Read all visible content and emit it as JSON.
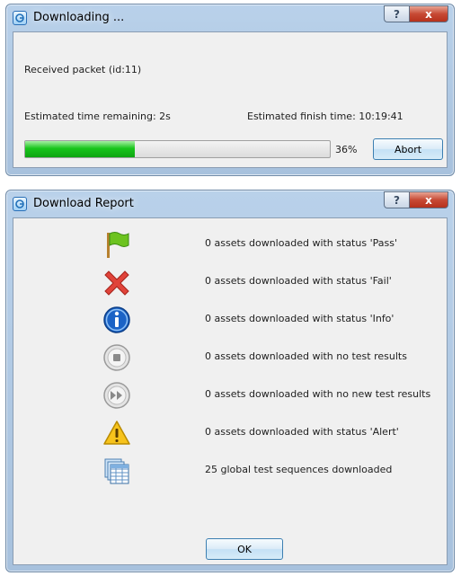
{
  "download_dialog": {
    "title": "Downloading ...",
    "status_message": "Received packet (id:11)",
    "time_remaining": "Estimated time remaining:  2s",
    "finish_time": "Estimated finish time:  10:19:41",
    "progress_fraction": 0.36,
    "progress_label": "36%",
    "abort_label": "Abort",
    "help_glyph": "?",
    "close_glyph": "x"
  },
  "report_dialog": {
    "title": "Download Report",
    "help_glyph": "?",
    "close_glyph": "x",
    "rows": [
      {
        "icon": "green-flag-icon",
        "label": "0 assets downloaded with status 'Pass'"
      },
      {
        "icon": "red-cross-icon",
        "label": "0 assets downloaded with status 'Fail'"
      },
      {
        "icon": "info-icon",
        "label": "0 assets downloaded with status 'Info'"
      },
      {
        "icon": "stop-icon",
        "label": "0 assets downloaded with no test results"
      },
      {
        "icon": "fast-forward-icon",
        "label": "0 assets downloaded with no new test results"
      },
      {
        "icon": "warning-icon",
        "label": "0 assets downloaded with status 'Alert'"
      },
      {
        "icon": "sequences-icon",
        "label": "25 global test sequences downloaded"
      }
    ],
    "ok_label": "OK"
  },
  "colors": {
    "progress_green": "#19c51c",
    "fail_red": "#e0433a",
    "info_blue": "#1b63c6",
    "warning_yellow": "#f7c31c",
    "flag_green": "#6cc31f",
    "close_red": "#c74a35"
  }
}
